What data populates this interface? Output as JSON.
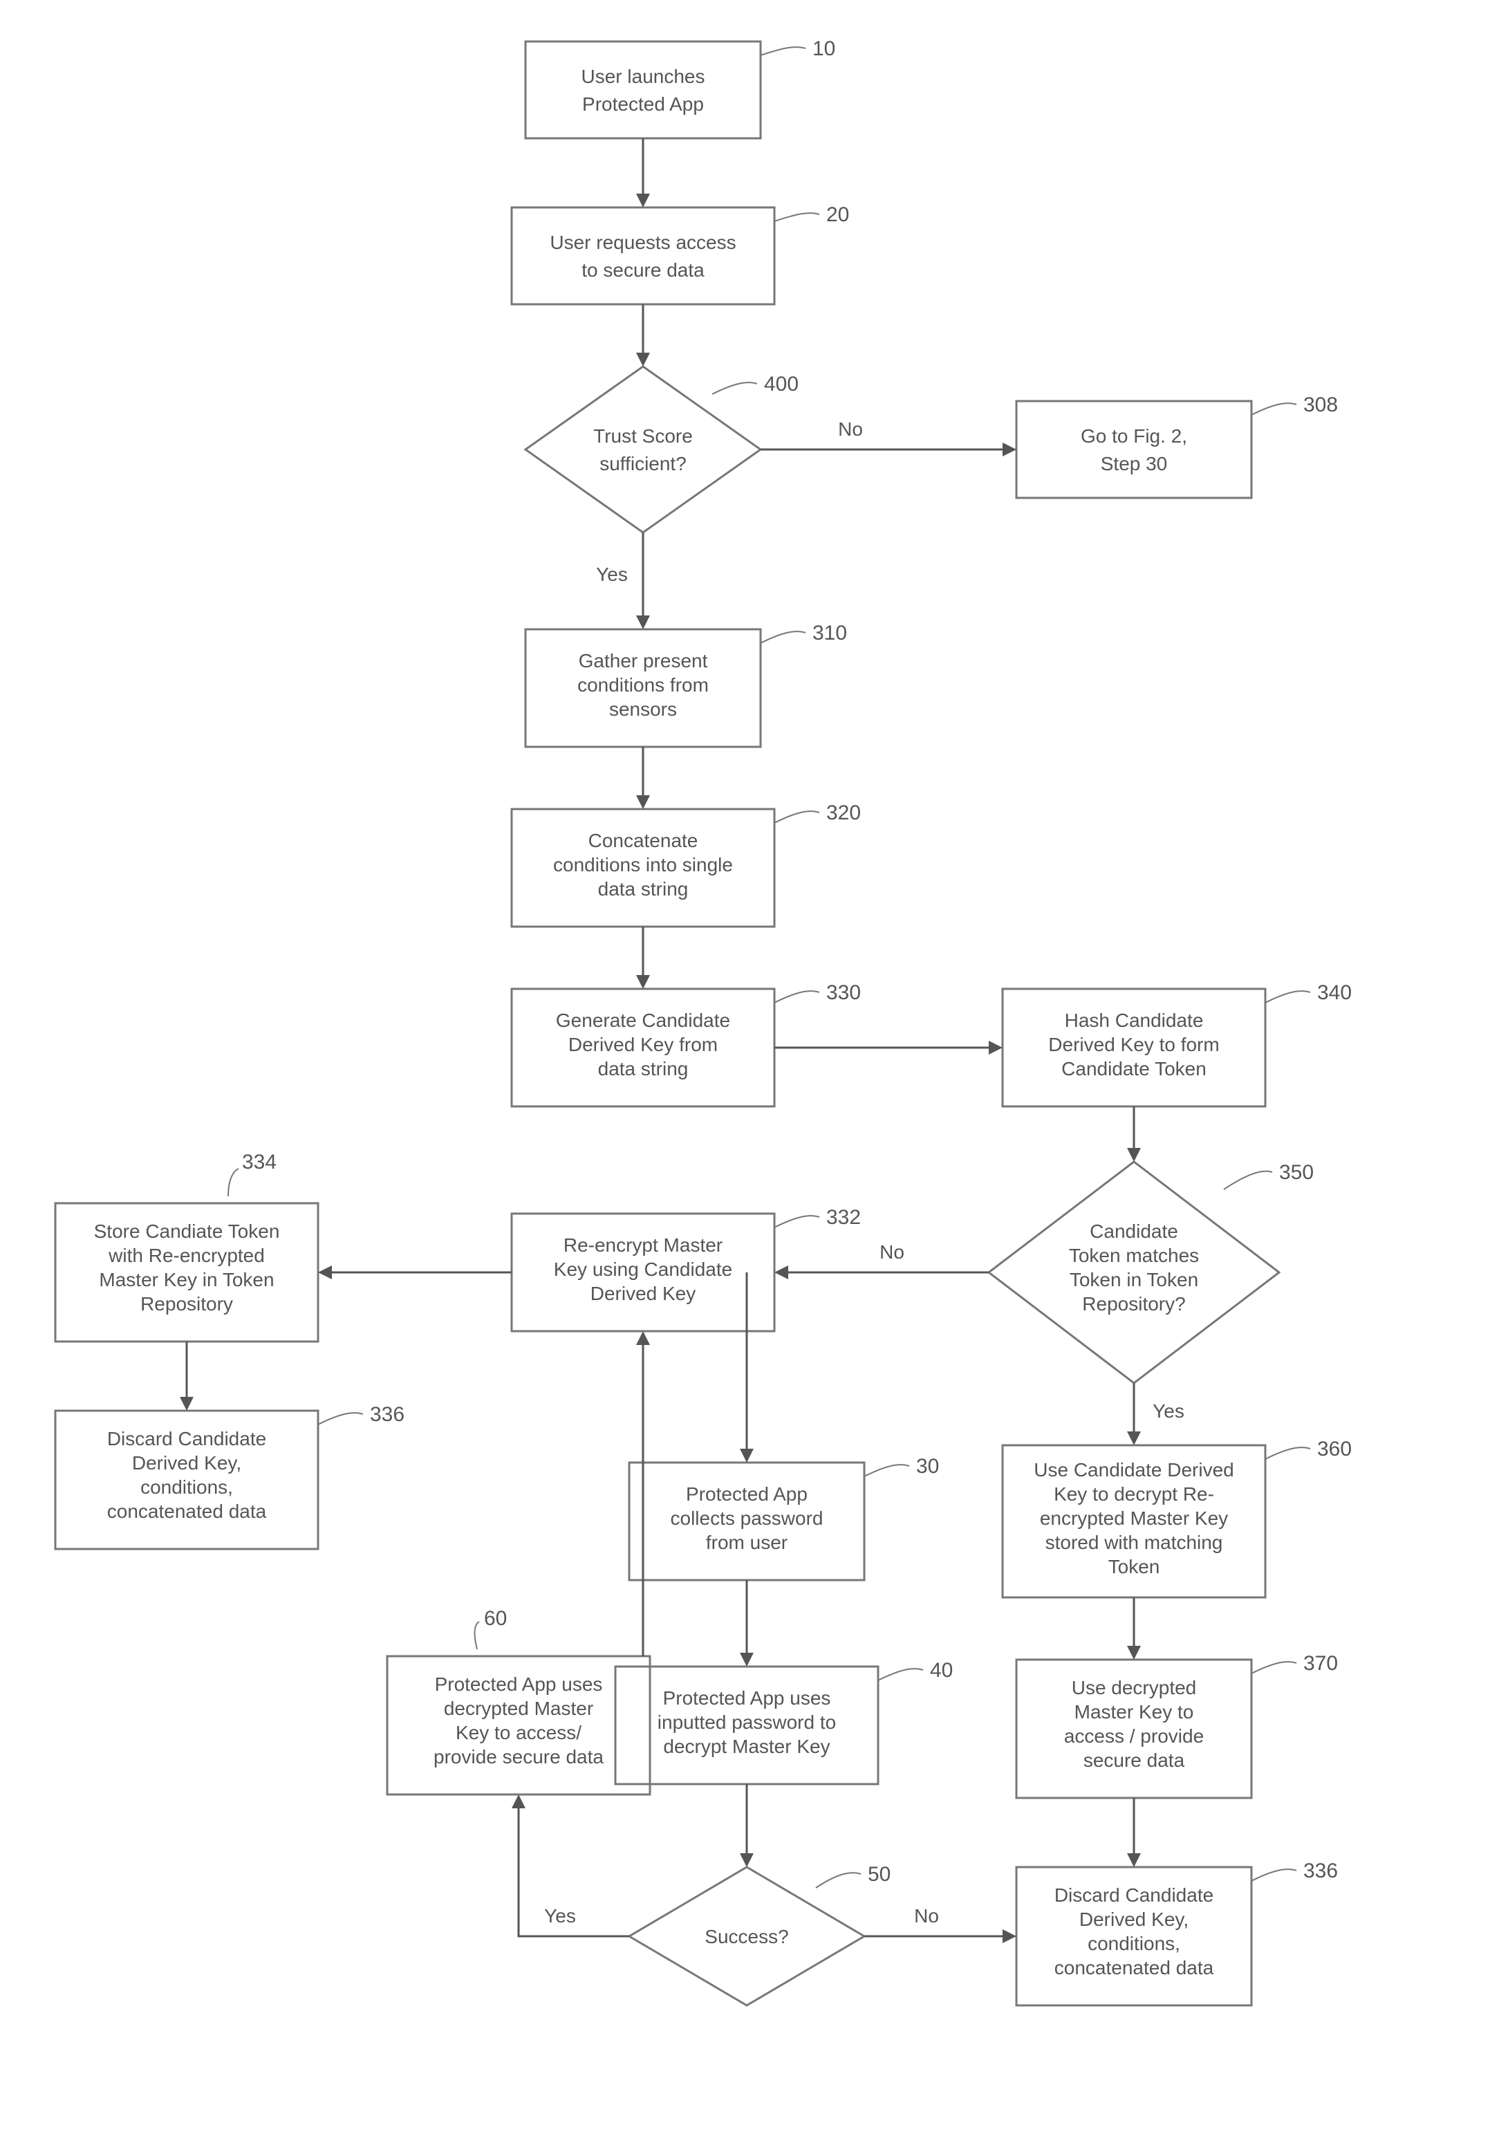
{
  "nodes": {
    "n10": {
      "label": "10",
      "lines": [
        "User launches",
        "Protected App"
      ]
    },
    "n20": {
      "label": "20",
      "lines": [
        "User requests access",
        "to secure data"
      ]
    },
    "n400": {
      "label": "400",
      "lines": [
        "Trust Score",
        "sufficient?"
      ]
    },
    "n308": {
      "label": "308",
      "lines": [
        "Go to Fig. 2,",
        "Step 30"
      ]
    },
    "n310": {
      "label": "310",
      "lines": [
        "Gather present",
        "conditions from",
        "sensors"
      ]
    },
    "n320": {
      "label": "320",
      "lines": [
        "Concatenate",
        "conditions into single",
        "data string"
      ]
    },
    "n330": {
      "label": "330",
      "lines": [
        "Generate Candidate",
        "Derived Key from",
        "data string"
      ]
    },
    "n340": {
      "label": "340",
      "lines": [
        "Hash Candidate",
        "Derived Key to form",
        "Candidate Token"
      ]
    },
    "n350": {
      "label": "350",
      "lines": [
        "Candidate",
        "Token matches",
        "Token in Token",
        "Repository?"
      ]
    },
    "n332": {
      "label": "332",
      "lines": [
        "Re-encrypt Master",
        "Key using Candidate",
        "Derived Key"
      ]
    },
    "n334": {
      "label": "334",
      "lines": [
        "Store Candiate Token",
        "with Re-encrypted",
        "Master Key in Token",
        "Repository"
      ]
    },
    "n336a": {
      "label": "336",
      "lines": [
        "Discard Candidate",
        "Derived Key,",
        "conditions,",
        "concatenated data"
      ]
    },
    "n30": {
      "label": "30",
      "lines": [
        "Protected App",
        "collects password",
        "from user"
      ]
    },
    "n360": {
      "label": "360",
      "lines": [
        "Use Candidate Derived",
        "Key to decrypt Re-",
        "encrypted Master Key",
        "stored with matching",
        "Token"
      ]
    },
    "n60": {
      "label": "60",
      "lines": [
        "Protected App uses",
        "decrypted Master",
        "Key to access/",
        "provide secure data"
      ]
    },
    "n40": {
      "label": "40",
      "lines": [
        "Protected App uses",
        "inputted password to",
        "decrypt Master Key"
      ]
    },
    "n370": {
      "label": "370",
      "lines": [
        "Use decrypted",
        "Master Key to",
        "access / provide",
        "secure data"
      ]
    },
    "n50": {
      "label": "50",
      "lines": [
        "Success?"
      ]
    },
    "n336b": {
      "label": "336",
      "lines": [
        "Discard Candidate",
        "Derived Key,",
        "conditions,",
        "concatenated data"
      ]
    }
  },
  "edgeLabels": {
    "e400_no": "No",
    "e400_yes": "Yes",
    "e350_no": "No",
    "e350_yes": "Yes",
    "e50_yes": "Yes",
    "e50_no": "No"
  }
}
